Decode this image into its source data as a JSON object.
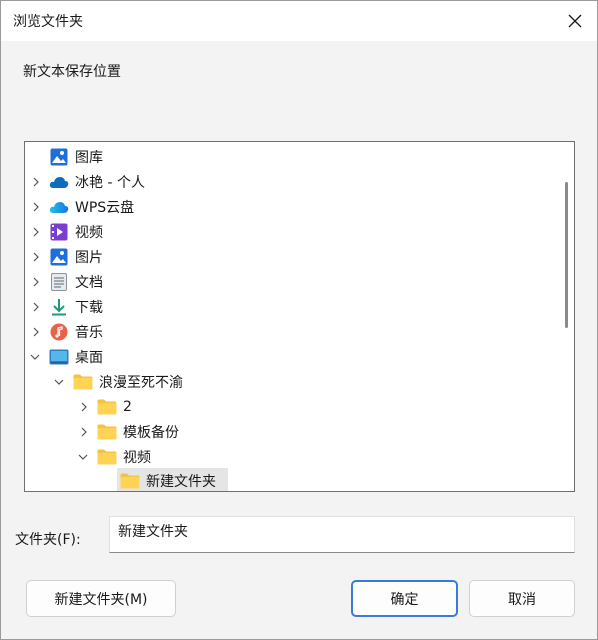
{
  "window": {
    "title": "浏览文件夹"
  },
  "prompt": "新文本保存位置",
  "tree": {
    "items": [
      {
        "label": "图库",
        "icon": "gallery-icon",
        "chevron": "none"
      },
      {
        "label": "冰艳 - 个人",
        "icon": "onedrive-cloud-icon",
        "chevron": "right"
      },
      {
        "label": "WPS云盘",
        "icon": "wps-cloud-icon",
        "chevron": "right"
      },
      {
        "label": "视频",
        "icon": "videos-folder-icon",
        "chevron": "right"
      },
      {
        "label": "图片",
        "icon": "pictures-folder-icon",
        "chevron": "right"
      },
      {
        "label": "文档",
        "icon": "documents-folder-icon",
        "chevron": "right"
      },
      {
        "label": "下载",
        "icon": "downloads-arrow-icon",
        "chevron": "right"
      },
      {
        "label": "音乐",
        "icon": "music-icon",
        "chevron": "right"
      },
      {
        "label": "桌面",
        "icon": "desktop-icon",
        "chevron": "down"
      },
      {
        "label": "浪漫至死不渝",
        "icon": "folder-icon",
        "chevron": "down"
      },
      {
        "label": "2",
        "icon": "folder-icon",
        "chevron": "right"
      },
      {
        "label": "模板备份",
        "icon": "folder-icon",
        "chevron": "right"
      },
      {
        "label": "视频",
        "icon": "folder-icon",
        "chevron": "down"
      },
      {
        "label": "新建文件夹",
        "icon": "folder-icon",
        "chevron": "none",
        "selected": true
      }
    ]
  },
  "folder_field": {
    "label": "文件夹(F):",
    "value": "新建文件夹"
  },
  "buttons": {
    "new_folder": "新建文件夹(M)",
    "ok": "确定",
    "cancel": "取消"
  },
  "colors": {
    "accent": "#3a7bd5",
    "folder": "#f5c342"
  }
}
